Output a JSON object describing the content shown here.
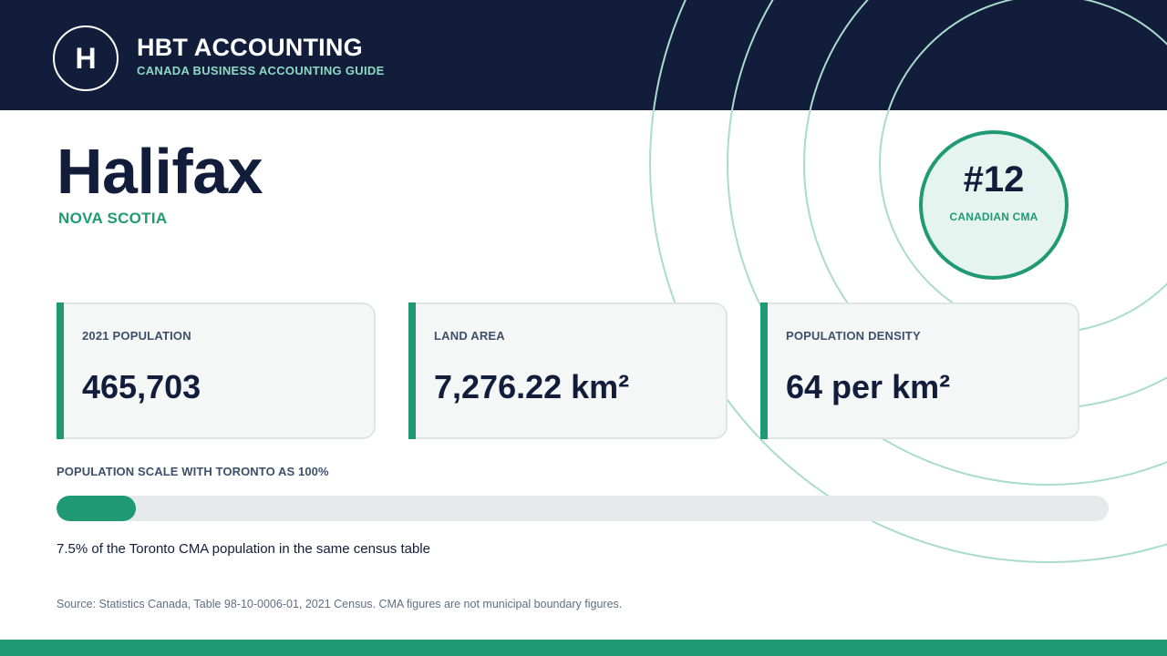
{
  "brand": {
    "logo_letter": "H",
    "name": "HBT ACCOUNTING",
    "tagline": "CANADA BUSINESS ACCOUNTING GUIDE"
  },
  "city": {
    "name": "Halifax",
    "province": "NOVA SCOTIA"
  },
  "rank": {
    "value": "#12",
    "label": "CANADIAN CMA"
  },
  "stats": [
    {
      "label": "2021 POPULATION",
      "value": "465,703"
    },
    {
      "label": "LAND AREA",
      "value": "7,276.22 km²"
    },
    {
      "label": "POPULATION DENSITY",
      "value": "64 per km²"
    }
  ],
  "population_scale": {
    "title": "POPULATION SCALE WITH TORONTO AS 100%",
    "percent": 7.5,
    "note": "7.5% of the Toronto CMA population in the same census table"
  },
  "source": "Source: Statistics Canada, Table 98-10-0006-01, 2021 Census. CMA figures are not municipal boundary figures.",
  "colors": {
    "navy": "#111d3b",
    "accent": "#1f9a73",
    "accent_light": "#8fd9c4"
  }
}
